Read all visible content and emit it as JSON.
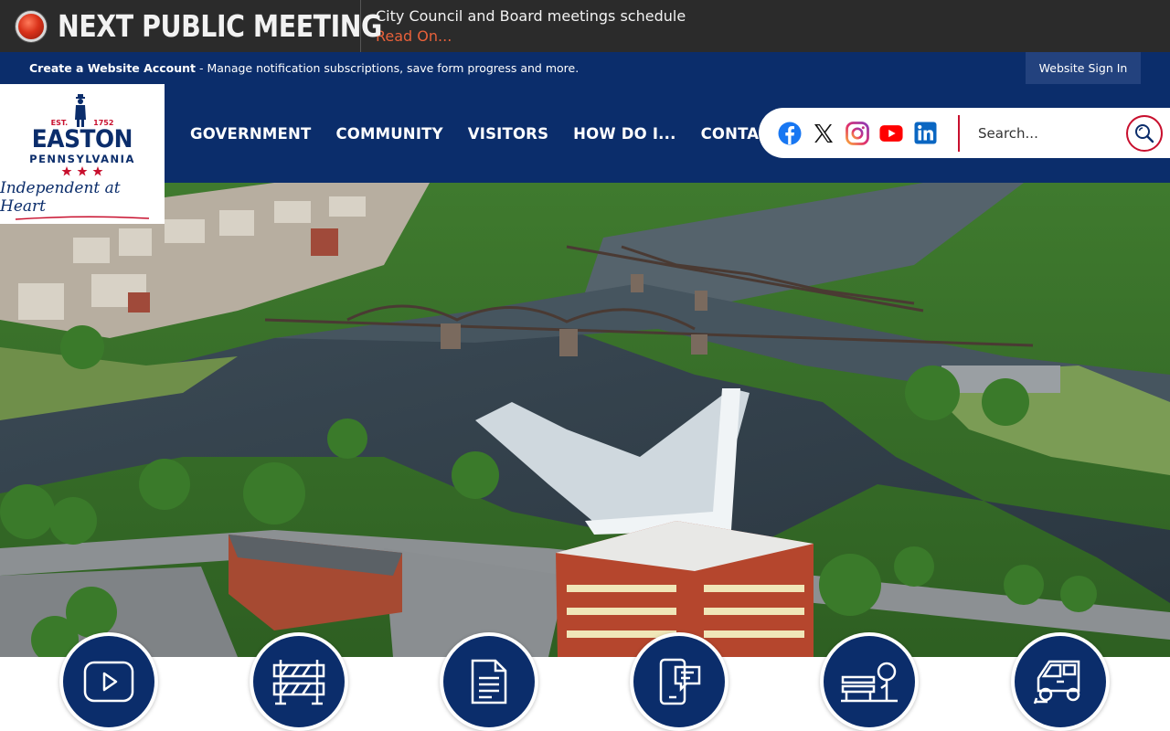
{
  "alert": {
    "title": "NEXT PUBLIC MEETING",
    "description": "City Council and Board meetings schedule",
    "link_label": "Read On..."
  },
  "account_bar": {
    "create_label": "Create a Website Account",
    "create_desc": " - Manage notification subscriptions, save form progress and more.",
    "signin_label": "Website Sign In"
  },
  "logo": {
    "est": "EST.",
    "year": "1752",
    "city": "EASTON",
    "state": "PENNSYLVANIA",
    "tagline": "Independent at Heart"
  },
  "nav": {
    "items": [
      "GOVERNMENT",
      "COMMUNITY",
      "VISITORS",
      "HOW DO I...",
      "CONTACT"
    ]
  },
  "social": [
    "facebook-icon",
    "x-icon",
    "instagram-icon",
    "youtube-icon",
    "linkedin-icon"
  ],
  "search": {
    "placeholder": "Search..."
  },
  "quick_links": [
    "video-play-icon",
    "road-barrier-icon",
    "document-icon",
    "mobile-chat-icon",
    "park-bench-icon",
    "street-sweeper-icon"
  ],
  "colors": {
    "brand_navy": "#0b2d6b",
    "accent_red": "#c8102e",
    "alert_bg": "#2b2b2b",
    "link_orange": "#e8613a"
  }
}
